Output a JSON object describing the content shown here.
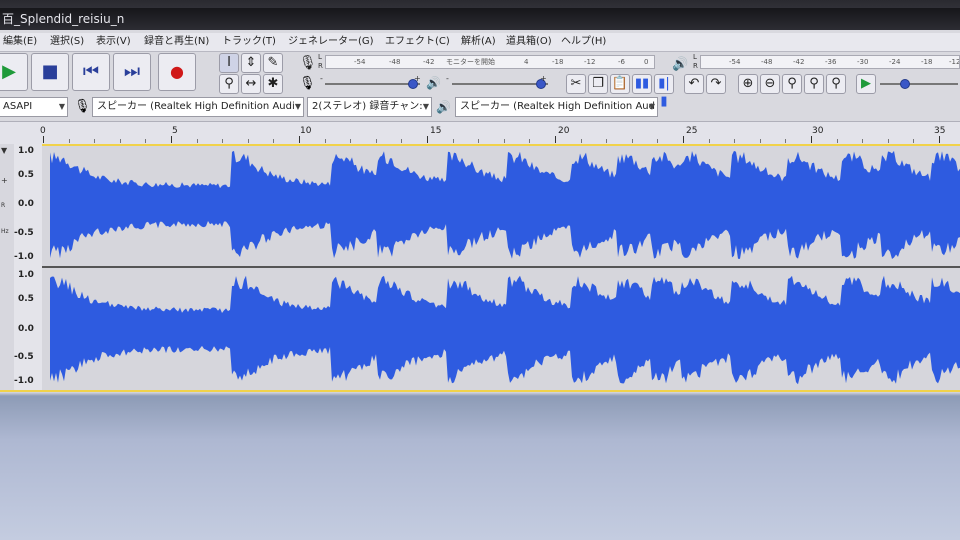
{
  "window": {
    "title": "百_Splendid_reisiu_n"
  },
  "menus": [
    "編集(E)",
    "選択(S)",
    "表示(V)",
    "録音と再生(N)",
    "トラック(T)",
    "ジェネレーター(G)",
    "エフェクト(C)",
    "解析(A)",
    "道具箱(O)",
    "ヘルプ(H)"
  ],
  "transport": {
    "play_icon": "play-icon",
    "stop_icon": "stop-icon",
    "skip_start_icon": "skip-start-icon",
    "skip_end_icon": "skip-end-icon",
    "record_icon": "record-icon",
    "colors": {
      "play": "#1f9a3a",
      "transport": "#2a3f9a",
      "record": "#d01818"
    }
  },
  "tools": [
    "selection-tool-icon",
    "envelope-tool-icon",
    "draw-tool-icon",
    "zoom-tool-icon",
    "time-shift-tool-icon",
    "multi-tool-icon"
  ],
  "record_meter": {
    "lr": [
      "L",
      "R"
    ],
    "ticks": [
      "-54",
      "-48",
      "-42"
    ],
    "monitor_label": "モニターを開始",
    "ticks2": [
      "4",
      "-18",
      "-12",
      "-6",
      "0"
    ]
  },
  "playback_meter": {
    "lr": [
      "L",
      "R"
    ],
    "ticks": [
      "-54",
      "-48",
      "-42",
      "-36",
      "-30",
      "-24",
      "-18",
      "-12"
    ]
  },
  "mixer": {
    "record_volume": 0.98,
    "playback_volume": 0.98,
    "rec_minus": "-",
    "rec_plus": "+",
    "play_minus": "-",
    "play_plus": "+"
  },
  "device_bar": {
    "host": "ASAPI",
    "playback_device": "スピーカー (Realtek High Definition Audi",
    "channels": "2(ステレオ) 録音チャン:",
    "recording_device": "スピーカー (Realtek High Definition Aud"
  },
  "edit_tools": [
    "cut-icon",
    "copy-icon",
    "paste-icon",
    "trim-icon",
    "silence-icon",
    "undo-icon",
    "redo-icon"
  ],
  "zoom_tools": [
    "zoom-in-icon",
    "zoom-out-icon",
    "fit-selection-icon",
    "fit-project-icon",
    "zoom-toggle-icon"
  ],
  "play_at_speed": {
    "icon": "play-at-speed-icon",
    "speed": 0.3
  },
  "ruler": {
    "labels": [
      "0",
      "5",
      "10",
      "15",
      "20",
      "25",
      "30",
      "35"
    ]
  },
  "track": {
    "scale": [
      "1.0",
      "0.5",
      "0.0",
      "-0.5",
      "-1.0"
    ],
    "side_labels": [
      "R",
      "Hz"
    ],
    "waveform_color": "#2e5be0",
    "background_color": "#d6d6dc"
  }
}
